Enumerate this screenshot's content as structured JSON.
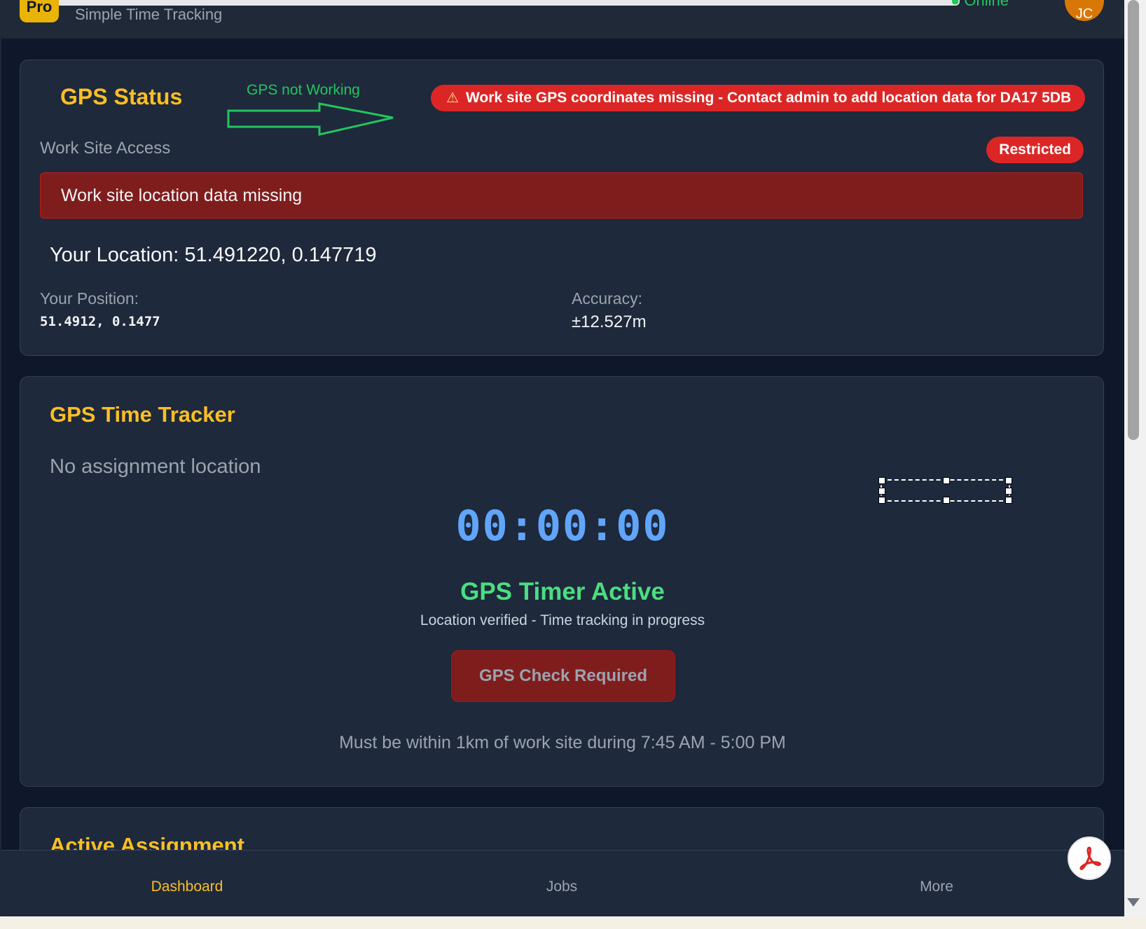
{
  "header": {
    "logo_text": "Pro",
    "subtitle": "Simple Time Tracking",
    "status": "● Online",
    "avatar_initials": "JC"
  },
  "gps_status": {
    "title": "GPS Status",
    "annotation_label": "GPS not Working",
    "warning_icon": "⚠",
    "warning_text": "Work site GPS coordinates missing - Contact admin to add location data for DA17 5DB",
    "access_label": "Work Site Access",
    "access_badge": "Restricted",
    "missing_banner": "Work site location data missing",
    "your_location": "Your Location: 51.491220, 0.147719",
    "position_label": "Your Position:",
    "position_value": "51.4912, 0.1477",
    "accuracy_label": "Accuracy:",
    "accuracy_value": "±12.527m"
  },
  "tracker": {
    "title": "GPS Time Tracker",
    "no_assignment": "No assignment location",
    "timer": "00:00:00",
    "status": "GPS Timer Active",
    "status_sub": "Location verified - Time tracking in progress",
    "button_label": "GPS Check Required",
    "within_text": "Must be within 1km of work site during 7:45 AM - 5:00 PM"
  },
  "assignment": {
    "title": "Active Assignment"
  },
  "nav": {
    "dashboard": "Dashboard",
    "jobs": "Jobs",
    "more": "More"
  },
  "fab_icon": "pdf-icon",
  "colors": {
    "accent": "#fbbf24",
    "danger": "#dc2626",
    "success": "#4ade80",
    "timer": "#60a5fa",
    "annotation": "#22c55e"
  }
}
